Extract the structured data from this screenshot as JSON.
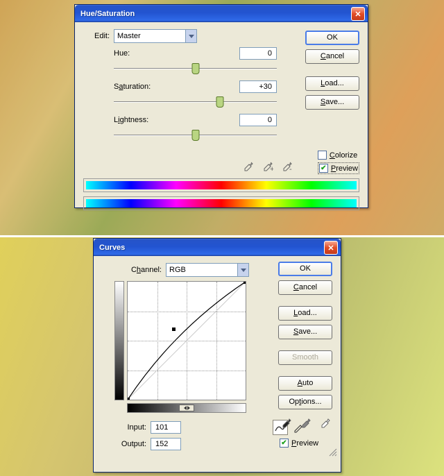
{
  "hue_dialog": {
    "title": "Hue/Saturation",
    "edit_label": "Edit:",
    "edit_value": "Master",
    "hue_label": "Hue:",
    "hue_value": "0",
    "sat_label": "Saturation:",
    "sat_value": "+30",
    "light_label": "Lightness:",
    "light_value": "0",
    "buttons": {
      "ok": "OK",
      "cancel": "Cancel",
      "load": "Load...",
      "save": "Save..."
    },
    "colorize_label": "Colorize",
    "preview_label": "Preview",
    "eyedroppers": [
      "eyedropper",
      "eyedropper-add",
      "eyedropper-subtract"
    ]
  },
  "curves_dialog": {
    "title": "Curves",
    "channel_label": "Channel:",
    "channel_value": "RGB",
    "input_label": "Input:",
    "input_value": "101",
    "output_label": "Output:",
    "output_value": "152",
    "buttons": {
      "ok": "OK",
      "cancel": "Cancel",
      "load": "Load...",
      "save": "Save...",
      "smooth": "Smooth",
      "auto": "Auto",
      "options": "Options..."
    },
    "preview_label": "Preview",
    "chart_data": {
      "type": "line",
      "xlabel": "Input",
      "ylabel": "Output",
      "xlim": [
        0,
        255
      ],
      "ylim": [
        0,
        255
      ],
      "points": [
        {
          "x": 0,
          "y": 0
        },
        {
          "x": 101,
          "y": 152
        },
        {
          "x": 255,
          "y": 255
        }
      ]
    }
  }
}
